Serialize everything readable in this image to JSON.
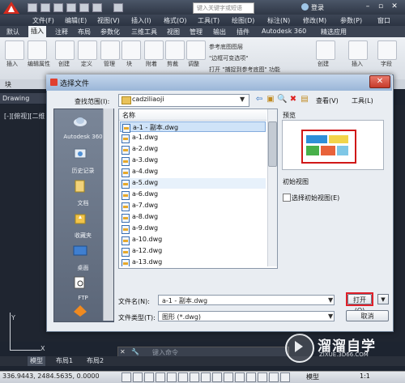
{
  "titlebar": {
    "search_placeholder": "键入关键字或短语",
    "login_label": "登录"
  },
  "menu": [
    "文件(F)",
    "编辑(E)",
    "视图(V)",
    "插入(I)",
    "格式(O)",
    "工具(T)",
    "绘图(D)",
    "标注(N)",
    "修改(M)",
    "参数(P)",
    "窗口"
  ],
  "ribbon_tabs": [
    "默认",
    "插入",
    "注释",
    "布局",
    "参数化",
    "三维工具",
    "视图",
    "管理",
    "输出",
    "插件",
    "Autodesk 360",
    "精选应用"
  ],
  "ribbon": {
    "buttons": [
      "插入",
      "编辑属性",
      "创建",
      "定义",
      "管理",
      "块",
      "附着",
      "剪裁",
      "调整",
      "创建",
      "插入",
      "字段"
    ],
    "ref_items": [
      "参考底图图层",
      "\"边框可变选项\"",
      "打开 \"捕捉到参考底图\" 功能"
    ],
    "panel_label": "块"
  },
  "drawing_tab": "Drawing",
  "view_label": "[-][俯视][二维",
  "ucs": {
    "y": "Y",
    "x": "X"
  },
  "dialog": {
    "title": "选择文件",
    "look_in_label": "查找范围(I):",
    "look_in_value": "cadziliaoji",
    "view_label": "查看(V)",
    "tools_label": "工具(L)",
    "places": [
      "Autodesk 360",
      "历史记录",
      "文档",
      "收藏夹",
      "桌面",
      "FTP",
      ""
    ],
    "column_name": "名称",
    "files": [
      "a-1 - 副本.dwg",
      "a-1.dwg",
      "a-2.dwg",
      "a-3.dwg",
      "a-4.dwg",
      "a-5.dwg",
      "a-6.dwg",
      "a-7.dwg",
      "a-8.dwg",
      "a-9.dwg",
      "a-10.dwg",
      "a-12.dwg",
      "a-13.dwg"
    ],
    "selected_file": "a-1 - 副本.dwg",
    "preview_label": "预览",
    "initial_view_label": "初始视图",
    "select_initial_view": "选择初始视图(E)",
    "filename_label": "文件名(N):",
    "filename_value": "a-1 - 副本.dwg",
    "filetype_label": "文件类型(T):",
    "filetype_value": "图形 (*.dwg)",
    "open_button": "打开(O)",
    "cancel_button": "取消"
  },
  "command": {
    "placeholder": "键入命令"
  },
  "layout_tabs": [
    "模型",
    "布局1",
    "布局2"
  ],
  "status": {
    "coords": "336.9443, 2484.5635, 0.0000",
    "model": "模型",
    "scale": "1:1"
  },
  "watermark": {
    "title": "溜溜自学",
    "url": "ZIXUE.3D66.COM"
  },
  "colors": {
    "highlight_red": "#e0202a",
    "selection_blue": "#cfe3f8",
    "app_dark": "#1f2530"
  }
}
